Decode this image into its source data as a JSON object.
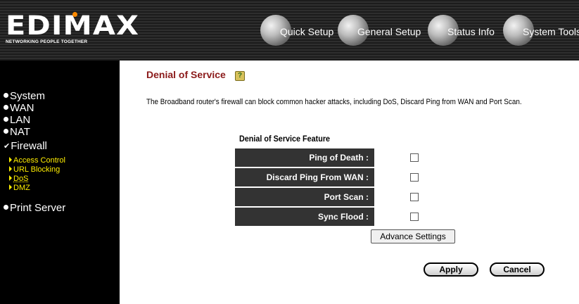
{
  "header": {
    "brand": "EDIMAX",
    "tagline": "NETWORKING PEOPLE TOGETHER",
    "nav": [
      {
        "label": "Quick Setup",
        "icon": "quick-setup-icon"
      },
      {
        "label": "General Setup",
        "icon": "general-setup-icon"
      },
      {
        "label": "Status Info",
        "icon": "status-info-icon"
      },
      {
        "label": "System Tools",
        "icon": "system-tools-icon"
      }
    ]
  },
  "sidebar": {
    "items": [
      {
        "label": "System"
      },
      {
        "label": "WAN"
      },
      {
        "label": "LAN"
      },
      {
        "label": "NAT"
      },
      {
        "label": "Firewall"
      },
      {
        "label": "Print Server"
      }
    ],
    "firewall_sub": [
      {
        "label": "Access Control"
      },
      {
        "label": "URL Blocking"
      },
      {
        "label": "DoS"
      },
      {
        "label": "DMZ"
      }
    ]
  },
  "content": {
    "title": "Denial of Service",
    "description": "The Broadband router's firewall can block common hacker attacks, including DoS, Discard Ping from WAN and Port Scan.",
    "feature_title": "Denial of Service Feature",
    "features": [
      {
        "label": "Ping of Death :",
        "checked": false
      },
      {
        "label": "Discard Ping From WAN :",
        "checked": false
      },
      {
        "label": "Port Scan :",
        "checked": false
      },
      {
        "label": "Sync Flood :",
        "checked": false
      }
    ],
    "advance_button": "Advance Settings",
    "apply_button": "Apply",
    "cancel_button": "Cancel"
  },
  "colors": {
    "title": "#8b1a1a",
    "submenu": "#ffee00",
    "row_bg": "#333333"
  }
}
